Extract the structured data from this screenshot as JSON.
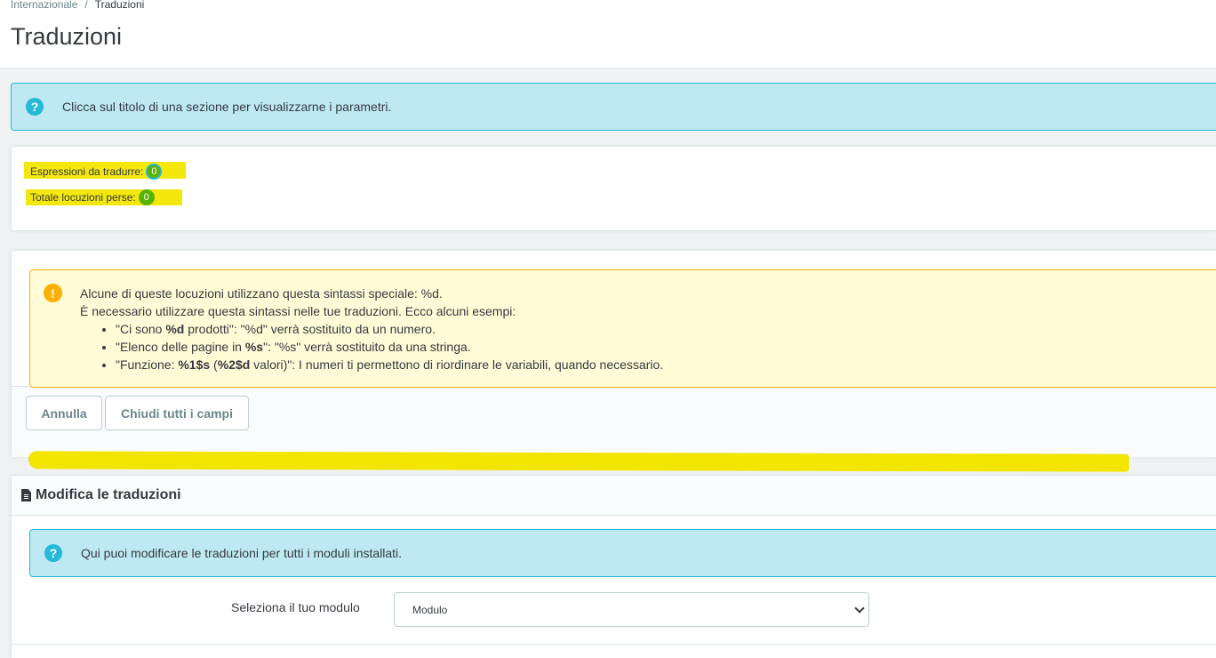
{
  "breadcrumb": {
    "parent": "Internazionale",
    "separator": "/",
    "current": "Traduzioni"
  },
  "page": {
    "title": "Traduzioni"
  },
  "info_alert": {
    "text": "Clicca sul titolo di una sezione per visualizzarne i parametri.",
    "icon": "question-circle-icon"
  },
  "stats": {
    "to_translate_label": "Espressioni da tradurre:",
    "to_translate_count": "0",
    "missing_label": "Totale locuzioni perse:",
    "missing_count": "0"
  },
  "warning": {
    "icon": "exclamation-circle-icon",
    "line1": "Alcune di queste locuzioni utilizzano questa sintassi speciale: %d.",
    "line2": "È necessario utilizzare questa sintassi nelle tue traduzioni. Ecco alcuni esempi:",
    "ex1_a": "\"Ci sono ",
    "ex1_b": "%d",
    "ex1_c": " prodotti\": \"%d\" verrà sostituito da un numero.",
    "ex2_a": "\"Elenco delle pagine in ",
    "ex2_b": "%s",
    "ex2_c": "\": \"%s\" verrà sostituito da una stringa.",
    "ex3_a": "\"Funzione: ",
    "ex3_b": "%1$s",
    "ex3_c": " (",
    "ex3_d": "%2$d",
    "ex3_e": " valori)\": I numeri ti permettono di riordinare le variabili, quando necessario."
  },
  "buttons": {
    "cancel": "Annulla",
    "close_all": "Chiudi tutti i campi"
  },
  "panel": {
    "title": "Modifica le traduzioni",
    "info": "Qui puoi modificare le traduzioni per tutti i moduli installati.",
    "select_label": "Seleziona il tuo modulo",
    "select_value": "Modulo"
  },
  "colors": {
    "info_bg": "#bee9f2",
    "info_accent": "#25b9d7",
    "warning_bg": "#fffbd6",
    "warning_accent": "#fab000",
    "highlight": "#f3e600",
    "badge": "#58b200"
  }
}
